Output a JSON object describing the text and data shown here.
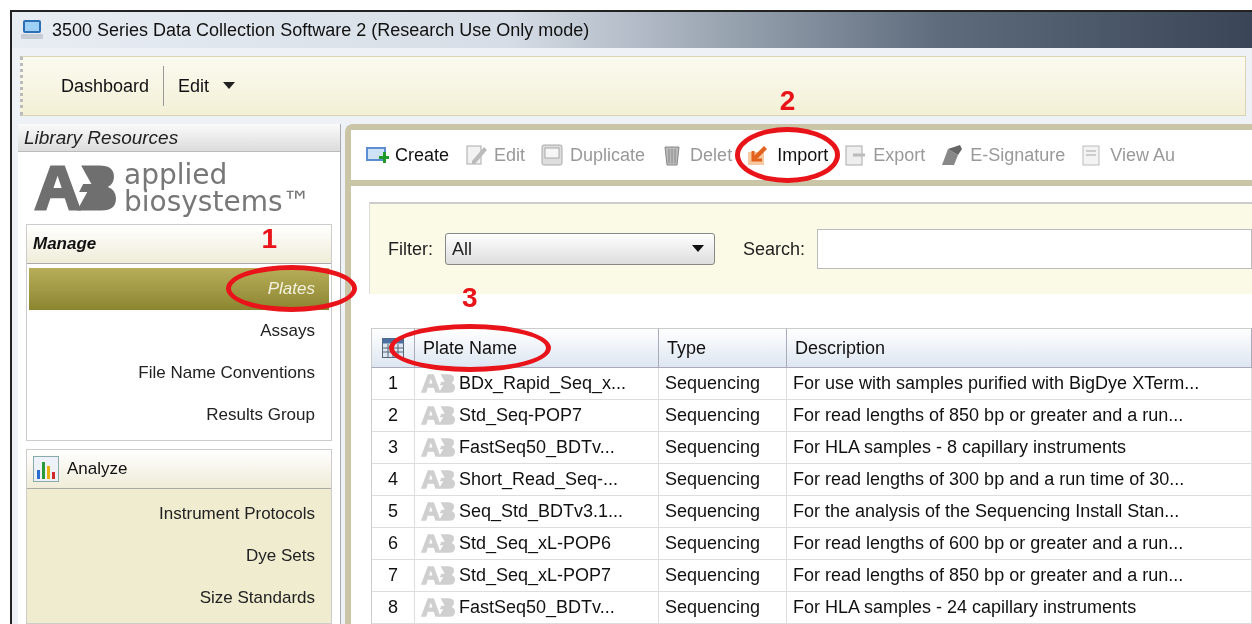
{
  "window": {
    "title": "3500 Series Data Collection Software 2 (Research Use Only mode)"
  },
  "menu": [
    {
      "label": "Dashboard",
      "kind": "plain"
    },
    {
      "label": "Edit",
      "kind": "dropdown"
    }
  ],
  "sidebar": {
    "title": "Library Resources",
    "logo": {
      "line1": "applied",
      "line2": "biosystems™"
    },
    "sections": [
      {
        "title": "Manage",
        "kind": "plain",
        "items": [
          {
            "label": "Plates",
            "selected": true
          },
          {
            "label": "Assays",
            "selected": false
          },
          {
            "label": "File Name Conventions",
            "selected": false
          },
          {
            "label": "Results Group",
            "selected": false
          }
        ]
      },
      {
        "title": "Analyze",
        "kind": "chart",
        "items": [
          {
            "label": "Instrument Protocols",
            "selected": false
          },
          {
            "label": "Dye Sets",
            "selected": false
          },
          {
            "label": "Size Standards",
            "selected": false
          }
        ]
      }
    ]
  },
  "actions": [
    {
      "label": "Create",
      "disabled": false
    },
    {
      "label": "Edit",
      "disabled": true
    },
    {
      "label": "Duplicate",
      "disabled": true
    },
    {
      "label": "Delet",
      "disabled": true
    },
    {
      "label": "Import",
      "disabled": false
    },
    {
      "label": "Export",
      "disabled": true
    },
    {
      "label": "E-Signature",
      "disabled": true
    },
    {
      "label": "View Au",
      "disabled": true
    }
  ],
  "filter": {
    "label": "Filter:",
    "value": "All"
  },
  "search": {
    "label": "Search:"
  },
  "table": {
    "columns": [
      "Plate Name",
      "Type",
      "Description"
    ],
    "rows": [
      {
        "number": "1",
        "name": "BDx_Rapid_Seq_x...",
        "type": "Sequencing",
        "description": "For use with samples purified with BigDye XTerm..."
      },
      {
        "number": "2",
        "name": "Std_Seq-POP7",
        "type": "Sequencing",
        "description": "For read lengths of 850 bp or greater and a run..."
      },
      {
        "number": "3",
        "name": "FastSeq50_BDTv...",
        "type": "Sequencing",
        "description": "For HLA samples - 8 capillary instruments"
      },
      {
        "number": "4",
        "name": "Short_Read_Seq-...",
        "type": "Sequencing",
        "description": "For read lengths of 300 bp and a run time of 30..."
      },
      {
        "number": "5",
        "name": "Seq_Std_BDTv3.1...",
        "type": "Sequencing",
        "description": "For the analysis of the Sequencing Install Stan..."
      },
      {
        "number": "6",
        "name": "Std_Seq_xL-POP6",
        "type": "Sequencing",
        "description": "For read lengths of 600 bp or greater and a run..."
      },
      {
        "number": "7",
        "name": "Std_Seq_xL-POP7",
        "type": "Sequencing",
        "description": "For read lengths of 850 bp or greater and a run..."
      },
      {
        "number": "8",
        "name": "FastSeq50_BDTv...",
        "type": "Sequencing",
        "description": "For HLA samples - 24 capillary instruments"
      }
    ]
  },
  "annotations": [
    {
      "label": "1"
    },
    {
      "label": "2"
    },
    {
      "label": "3"
    }
  ]
}
